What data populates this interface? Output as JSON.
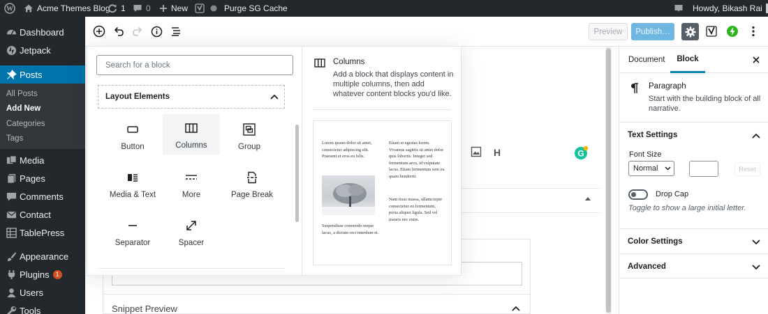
{
  "adminbar": {
    "site_name": "Acme Themes Blog",
    "updates_count": "1",
    "comments_count": "0",
    "new_label": "New",
    "purge_label": "Purge SG Cache",
    "howdy": "Howdy, Bikash Rai"
  },
  "sidebar": {
    "items": [
      {
        "label": "Dashboard",
        "icon": "dashboard-icon"
      },
      {
        "label": "Jetpack",
        "icon": "jetpack-icon"
      },
      {
        "label": "Posts",
        "icon": "pin-icon"
      },
      {
        "label": "Media",
        "icon": "media-icon"
      },
      {
        "label": "Pages",
        "icon": "pages-icon"
      },
      {
        "label": "Comments",
        "icon": "comment-icon"
      },
      {
        "label": "Contact",
        "icon": "mail-icon"
      },
      {
        "label": "TablePress",
        "icon": "table-icon"
      },
      {
        "label": "Appearance",
        "icon": "brush-icon"
      },
      {
        "label": "Plugins",
        "icon": "plugin-icon",
        "badge": "1"
      },
      {
        "label": "Users",
        "icon": "user-icon"
      },
      {
        "label": "Tools",
        "icon": "wrench-icon"
      }
    ],
    "posts_sub": [
      "All Posts",
      "Add New",
      "Categories",
      "Tags"
    ]
  },
  "toolbar": {
    "preview_label": "Preview",
    "publish_label": "Publish…"
  },
  "inserter": {
    "search_placeholder": "Search for a block",
    "category_title": "Layout Elements",
    "blocks": [
      {
        "label": "Button",
        "icon": "button-icon"
      },
      {
        "label": "Columns",
        "icon": "columns-icon",
        "selected": true
      },
      {
        "label": "Group",
        "icon": "group-icon"
      },
      {
        "label": "Media & Text",
        "icon": "media-text-icon"
      },
      {
        "label": "More",
        "icon": "more-icon"
      },
      {
        "label": "Page Break",
        "icon": "page-break-icon"
      },
      {
        "label": "Separator",
        "icon": "separator-icon"
      },
      {
        "label": "Spacer",
        "icon": "spacer-icon"
      }
    ],
    "preview": {
      "title": "Columns",
      "description": "Add a block that displays content in multiple columns, then add whatever content blocks you'd like.",
      "col1_text": "Lorem ipsum dolor sit amet, consectetur adipiscing elit. Praesent et eros eu felis.",
      "col1_caption": "Suspendisse commodo neque lacus, a dictum orci interdum et.",
      "col2_text1": "Etiam et egestas lorem. Vivamus sagittis sit amet dolor quis lobortis. Integer sed fermentum arcu, id vulputate lacus. Etiam fermentum sem eu quam hendrerit.",
      "col2_text2": "Nam risus massa, ullamcorper consectetur eu fermentum, porta aliquet ligula. Sed vel mauris nec enim."
    }
  },
  "editor": {
    "heading_letter": "H",
    "snippet_preview": "Snippet Preview"
  },
  "panel": {
    "tab_document": "Document",
    "tab_block": "Block",
    "block_name": "Paragraph",
    "block_desc": "Start with the building block of all narrative.",
    "text_settings": "Text Settings",
    "font_size_label": "Font Size",
    "font_size_value": "Normal",
    "reset_label": "Reset",
    "drop_cap_label": "Drop Cap",
    "drop_cap_help": "Toggle to show a large initial letter.",
    "color_settings": "Color Settings",
    "advanced": "Advanced"
  },
  "colors": {
    "admin_dark": "#23282d",
    "accent": "#0073aa",
    "publish": "#6fb7e0",
    "grammarly": "#15c39a",
    "badge": "#d54e21"
  }
}
